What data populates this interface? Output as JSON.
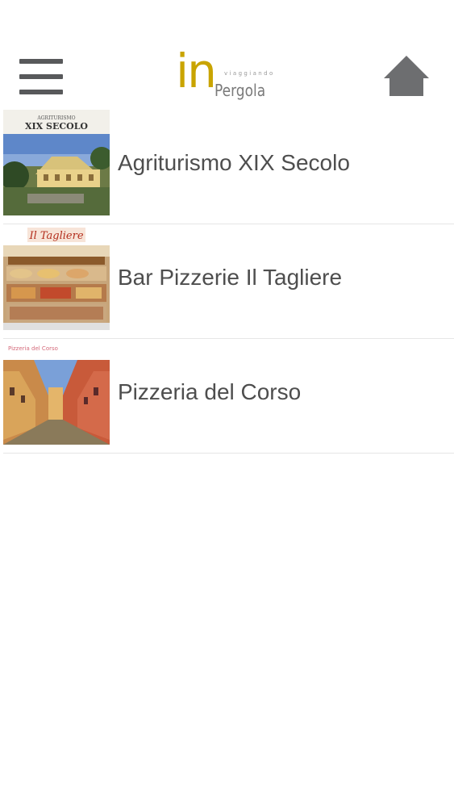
{
  "header": {
    "logo": {
      "prefix": "in",
      "tagline": "viaggiando",
      "place": "Pergola"
    },
    "menu_icon": "hamburger-menu-icon",
    "home_icon": "home-icon"
  },
  "list": {
    "items": [
      {
        "title": "Agriturismo XIX Secolo",
        "thumb_caption_small": "AGRITURISMO",
        "thumb_caption": "XIX SECOLO"
      },
      {
        "title": "Bar Pizzerie Il Tagliere",
        "thumb_caption": "Il Tagliere"
      },
      {
        "title": "Pizzeria del Corso",
        "thumb_caption": "Pizzeria del Corso"
      }
    ]
  },
  "colors": {
    "logo_gold": "#c9a400",
    "icon_gray": "#58595b",
    "text_gray": "#4e4e4e",
    "divider": "#e6e6e6"
  }
}
